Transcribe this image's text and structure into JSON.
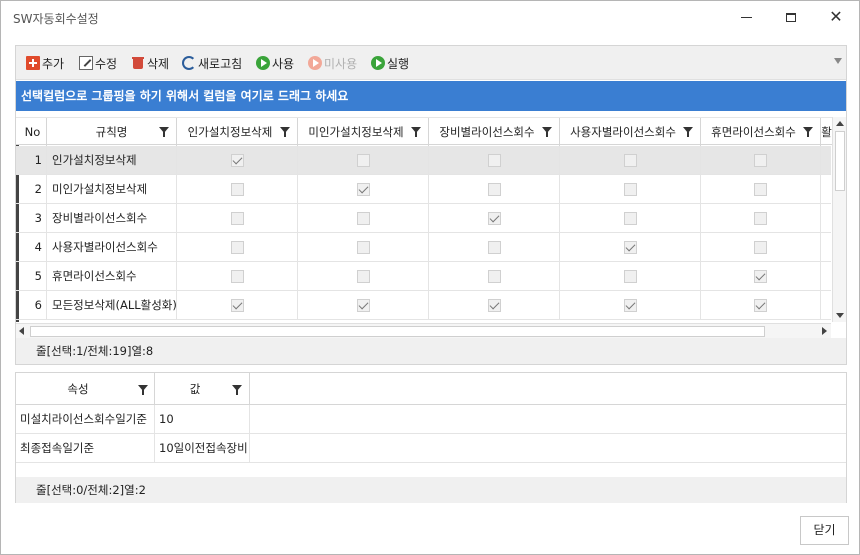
{
  "window": {
    "title": "SW자동회수설정"
  },
  "toolbar": {
    "add": "추가",
    "edit": "수정",
    "delete": "삭제",
    "refresh": "새로고침",
    "use": "사용",
    "unuse": "미사용",
    "run": "실행"
  },
  "group_hint": "선택컬럼으로 그룹핑을 하기 위해서 컬럼을 여기로 드래그 하세요",
  "grid": {
    "columns": [
      "No",
      "규칙명",
      "인가설치정보삭제",
      "미인가설치정보삭제",
      "장비별라이선스회수",
      "사용자별라이선스회수",
      "휴면라이선스회수",
      "활"
    ],
    "rows": [
      {
        "no": "1",
        "name": "인가설치정보삭제",
        "checks": [
          true,
          false,
          false,
          false,
          false
        ]
      },
      {
        "no": "2",
        "name": "미인가설치정보삭제",
        "checks": [
          false,
          true,
          false,
          false,
          false
        ]
      },
      {
        "no": "3",
        "name": "장비별라이선스회수",
        "checks": [
          false,
          false,
          true,
          false,
          false
        ]
      },
      {
        "no": "4",
        "name": "사용자별라이선스회수",
        "checks": [
          false,
          false,
          false,
          true,
          false
        ]
      },
      {
        "no": "5",
        "name": "휴면라이선스회수",
        "checks": [
          false,
          false,
          false,
          false,
          true
        ]
      },
      {
        "no": "6",
        "name": "모든정보삭제(ALL활성화)",
        "checks": [
          true,
          true,
          true,
          true,
          true
        ]
      }
    ],
    "status": "줄[선택:1/전체:19]열:8"
  },
  "props": {
    "columns": [
      "속성",
      "값"
    ],
    "rows": [
      {
        "key": "미설치라이선스회수일기준",
        "value": "10"
      },
      {
        "key": "최종접속일기준",
        "value": "10일이전접속장비"
      }
    ],
    "status": "줄[선택:0/전체:2]열:2"
  },
  "footer": {
    "close": "닫기"
  }
}
